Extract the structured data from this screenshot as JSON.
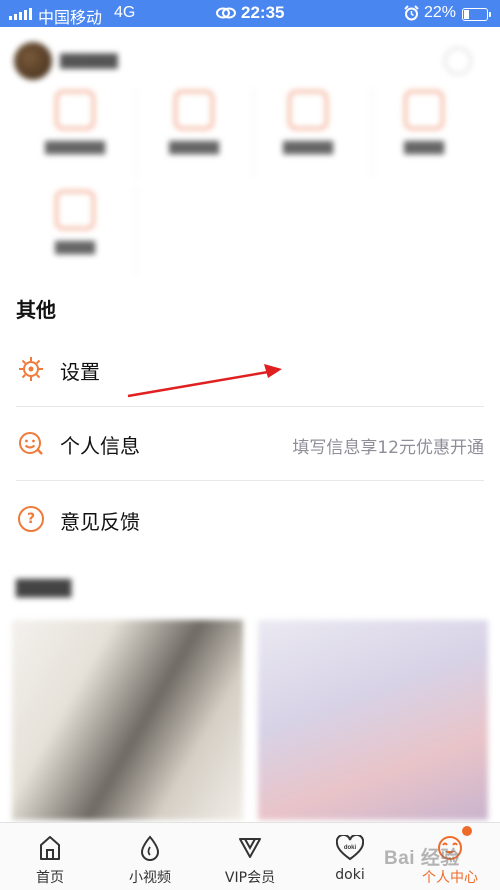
{
  "status_bar": {
    "carrier": "中国移动",
    "network": "4G",
    "time": "22:35",
    "battery_text": "22%",
    "battery_level": 0.22
  },
  "other_section": {
    "title": "其他",
    "rows": [
      {
        "label": "设置",
        "icon": "gear-icon"
      },
      {
        "label": "个人信息",
        "icon": "smile-icon",
        "hint": "填写信息享12元优惠开通"
      },
      {
        "label": "意见反馈",
        "icon": "question-icon"
      }
    ]
  },
  "annotation": {
    "color": "#e02020"
  },
  "tab_bar": {
    "tabs": [
      {
        "label": "首页",
        "icon": "home-icon"
      },
      {
        "label": "小视频",
        "icon": "drop-icon"
      },
      {
        "label": "VIP会员",
        "icon": "vip-icon"
      },
      {
        "label": "doki",
        "icon": "doki-heart-icon"
      },
      {
        "label": "个人中心",
        "icon": "profile-face-icon",
        "active": true
      }
    ],
    "accent": "#ef6b2a"
  },
  "watermark": "Bai 经验"
}
